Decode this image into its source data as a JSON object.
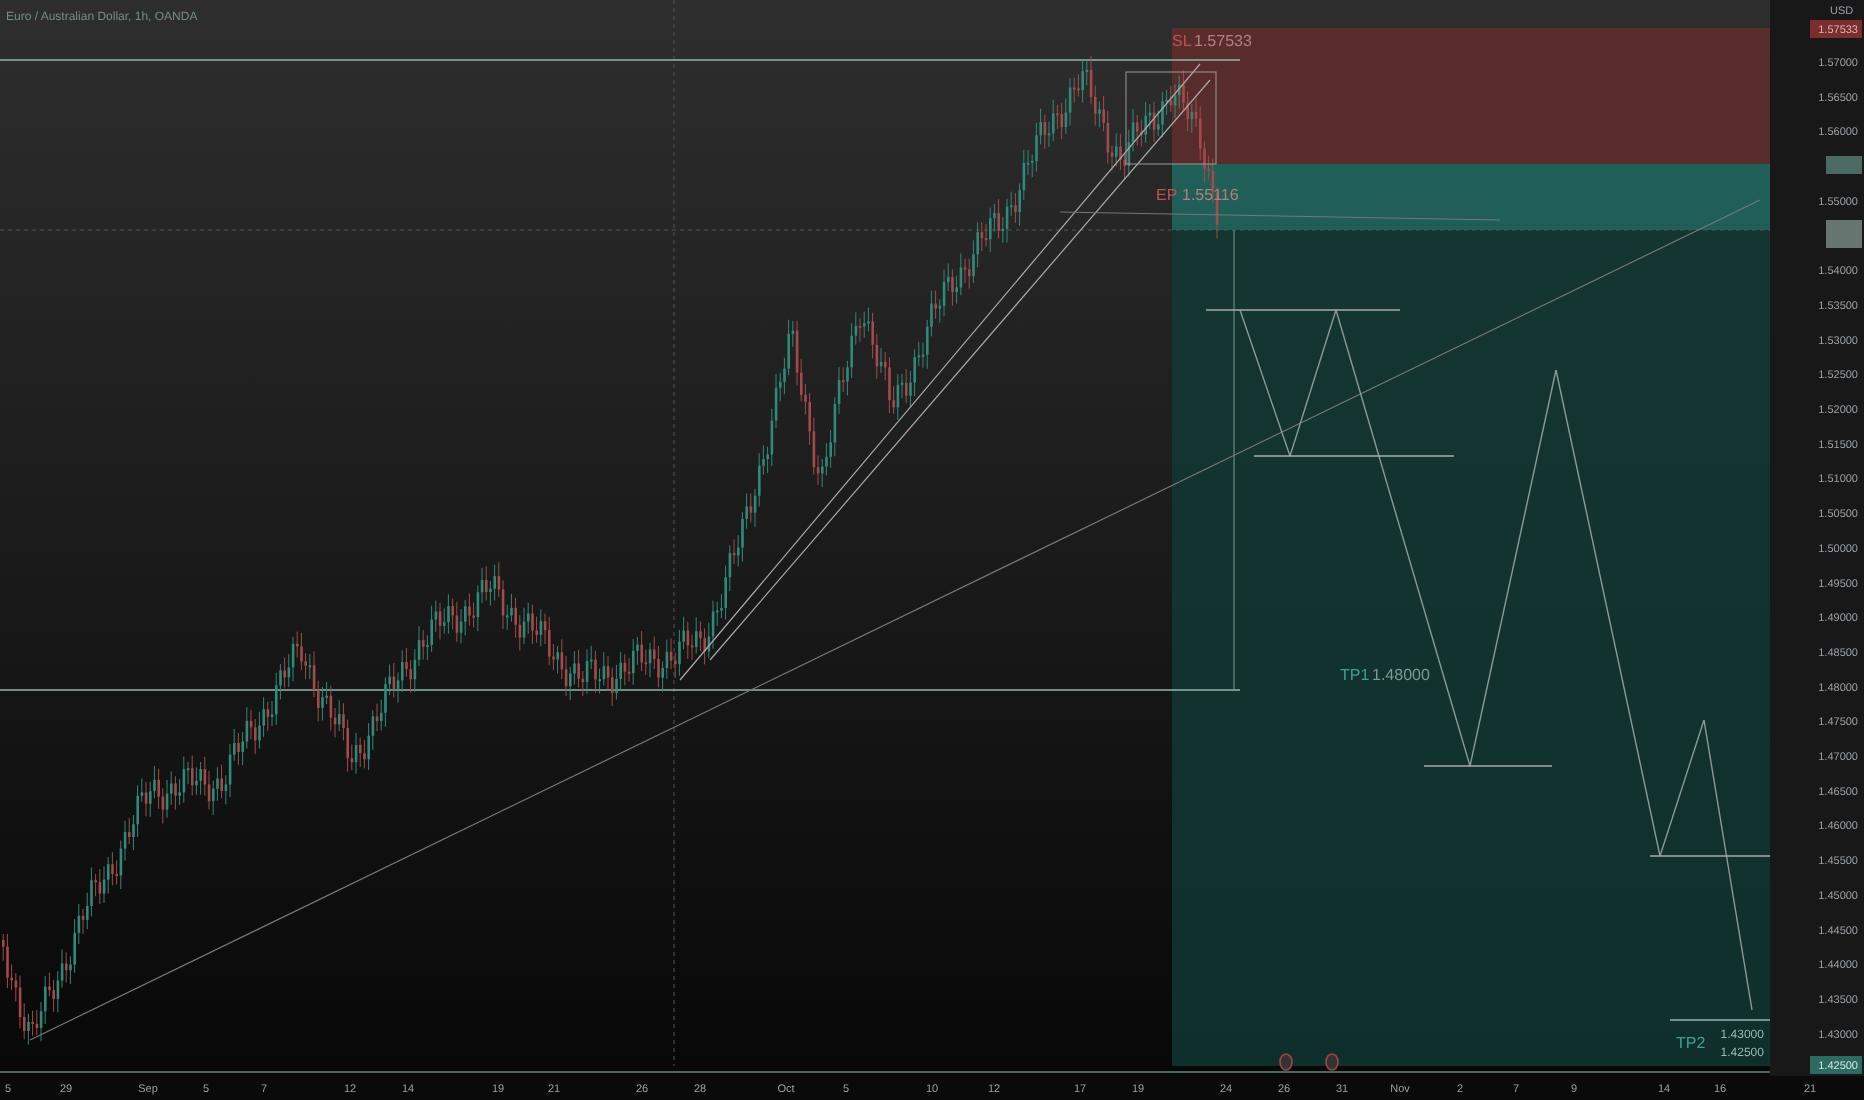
{
  "title": "Euro / Australian Dollar, 1h, OANDA",
  "price_axis": {
    "currency": "USD",
    "top_tag": "1.57533",
    "bottom_tag": "1.42500",
    "labels": [
      "1.57000",
      "1.56500",
      "1.56000",
      "1.55000",
      "1.54000",
      "1.53500",
      "1.53000",
      "1.52500",
      "1.52000",
      "1.51500",
      "1.51000",
      "1.50500",
      "1.50000",
      "1.49500",
      "1.49000",
      "1.48500",
      "1.48000",
      "1.47500",
      "1.47000",
      "1.46500",
      "1.46000",
      "1.45500",
      "1.45000",
      "1.44500",
      "1.44000",
      "1.43500",
      "1.43000"
    ]
  },
  "time_axis": [
    "5",
    "29",
    "Sep",
    "5",
    "7",
    "12",
    "14",
    "19",
    "21",
    "26",
    "28",
    "Oct",
    "5",
    "10",
    "12",
    "17",
    "19",
    "24",
    "26",
    "31",
    "Nov",
    "2",
    "7",
    "9",
    "14",
    "16",
    "21"
  ],
  "position": {
    "stop_label": "SL",
    "stop": "1.57533",
    "entry_label": "EP",
    "entry": "1.55116",
    "tp1_label": "TP1",
    "tp1": "1.48000",
    "tp2_label": "TP2",
    "tp2": "1.43000",
    "tp2_alt": "1.42500"
  }
}
